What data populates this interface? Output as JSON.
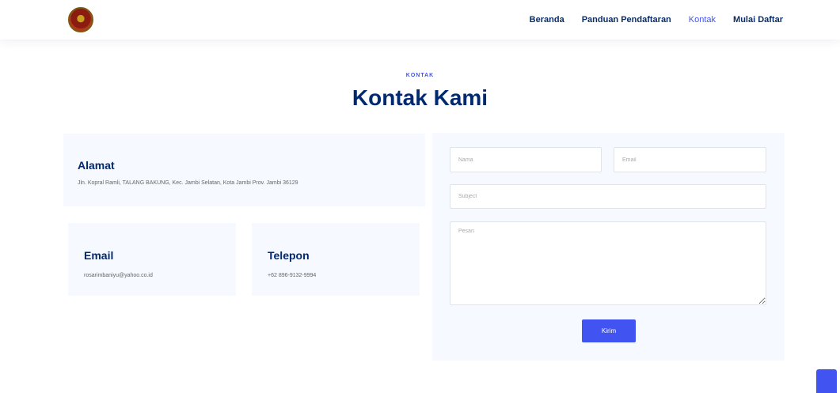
{
  "header": {
    "logo": "coat-of-arms-logo",
    "nav": [
      "Beranda",
      "Panduan Pendaftaran",
      "Kontak",
      "Mulai Daftar"
    ],
    "active_nav": "Kontak"
  },
  "section": {
    "label": "KONTAK",
    "title": "Kontak Kami"
  },
  "info": {
    "alamat": {
      "title": "Alamat",
      "text": "Jln. Kopral Ramli, TALANG BAKUNG, Kec. Jambi Selatan, Kota Jambi Prov. Jambi 36129"
    },
    "email": {
      "title": "Email",
      "text": "rosarimbaniyu@yahoo.co.id"
    },
    "telepon": {
      "title": "Telepon",
      "text": "+62 896-9132-9994"
    }
  },
  "form": {
    "name_placeholder": "Nama",
    "email_placeholder": "Email",
    "subject_placeholder": "Subject",
    "message_placeholder": "Pesan",
    "submit_label": "Kirim"
  },
  "colors": {
    "primary": "#4154f1",
    "heading": "#012970",
    "card_bg": "#f6f9ff"
  }
}
